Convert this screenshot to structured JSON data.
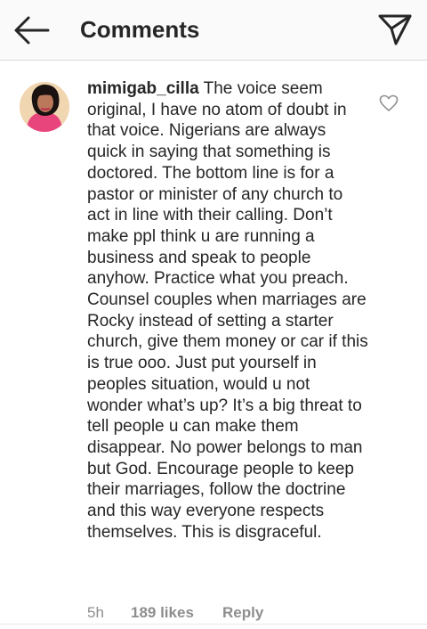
{
  "header": {
    "title": "Comments",
    "back_icon": "arrow-left-icon",
    "send_icon": "paper-plane-icon"
  },
  "comment": {
    "avatar_icon": "profile-photo",
    "username": "mimigab_cilla",
    "text": "The voice seem original, I have no atom of doubt in that voice. Nigerians are always quick in saying that something is doctored. The bottom line is for a pastor or minister of any church to act in line with their calling. Don’t make ppl think u are running a business and speak to people anyhow. Practice what you preach. Counsel couples when marriages are Rocky instead of setting a starter church, give them money or car if this is true ooo. Just put yourself in peoples situation, would u not wonder what’s up? It’s a big threat to tell people u can make them disappear. No power belongs to man but God. Encourage people to keep their marriages, follow the doctrine and this way everyone respects themselves. This is disgraceful.",
    "time": "5h",
    "likes": "189 likes",
    "reply_label": "Reply",
    "like_icon": "heart-outline-icon"
  },
  "colors": {
    "text": "#262626",
    "secondary": "#8e8e8e",
    "header_bg": "#fafafa",
    "divider": "#d8d8d8"
  }
}
